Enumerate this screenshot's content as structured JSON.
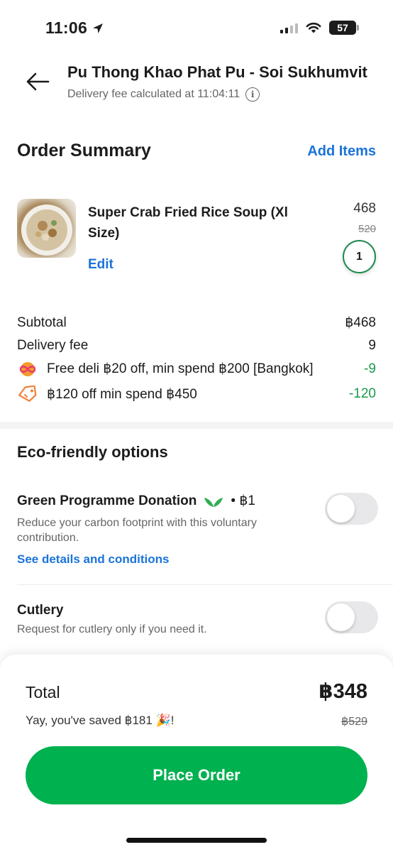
{
  "status_bar": {
    "time": "11:06",
    "battery": "57"
  },
  "header": {
    "restaurant": "Pu Thong Khao Phat Pu - Soi Sukhumvit",
    "fee_note": "Delivery fee calculated at 11:04:11"
  },
  "order_summary": {
    "title": "Order Summary",
    "add_items_label": "Add Items",
    "items": [
      {
        "name": "Super Crab Fried Rice Soup (Xl Size)",
        "edit_label": "Edit",
        "price": "468",
        "original_price": "520",
        "quantity": "1"
      }
    ]
  },
  "breakdown": {
    "subtotal_label": "Subtotal",
    "subtotal_value": "฿468",
    "delivery_label": "Delivery fee",
    "delivery_value": "9",
    "promos": [
      {
        "icon": "infinity-promo-icon",
        "label": "Free deli ฿20 off, min spend ฿200 [Bangkok]",
        "value": "-9"
      },
      {
        "icon": "tag-icon",
        "label": "฿120 off min spend ฿450",
        "value": "-120"
      }
    ]
  },
  "eco": {
    "title": "Eco-friendly options",
    "green": {
      "title": "Green Programme Donation",
      "price": "• ฿1",
      "desc": "Reduce your carbon footprint with this voluntary contribution.",
      "link": "See details and conditions",
      "enabled": false
    },
    "cutlery": {
      "title": "Cutlery",
      "desc": "Request for cutlery only if you need it.",
      "enabled": false
    }
  },
  "footer": {
    "total_label": "Total",
    "total_value": "฿348",
    "saved_text": "Yay, you've saved ฿181 🎉!",
    "original_total": "฿529",
    "place_order_label": "Place Order"
  },
  "colors": {
    "accent": "#00b14f",
    "link": "#1a73d9",
    "discount": "#1a9b4b"
  }
}
